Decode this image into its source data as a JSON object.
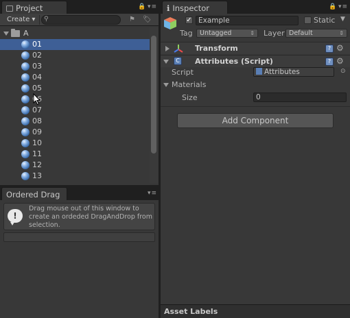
{
  "project": {
    "tab_title": "Project",
    "create_label": "Create",
    "search_placeholder": "",
    "folder_name": "A",
    "items": [
      "01",
      "02",
      "03",
      "04",
      "05",
      "06",
      "07",
      "08",
      "09",
      "10",
      "11",
      "12",
      "13"
    ],
    "selected_index": 0
  },
  "ordered_drag": {
    "tab_title": "Ordered Drag",
    "help_icon": "!",
    "help_text": "Drag mouse out of this window to create an ordeded DragAndDrop from selection."
  },
  "inspector": {
    "tab_title": "Inspector",
    "object_name": "Example",
    "object_active": true,
    "static_label": "Static",
    "static_checked": false,
    "tag_label": "Tag",
    "tag_value": "Untagged",
    "layer_label": "Layer",
    "layer_value": "Default",
    "transform_title": "Transform",
    "attributes_title": "Attributes (Script)",
    "script_label": "Script",
    "script_value": "Attributes",
    "materials_label": "Materials",
    "size_label": "Size",
    "size_value": "0",
    "add_component_label": "Add Component",
    "asset_labels": "Asset Labels"
  },
  "colors": {
    "selection": "#3e5f96",
    "panel_bg": "#383838"
  }
}
